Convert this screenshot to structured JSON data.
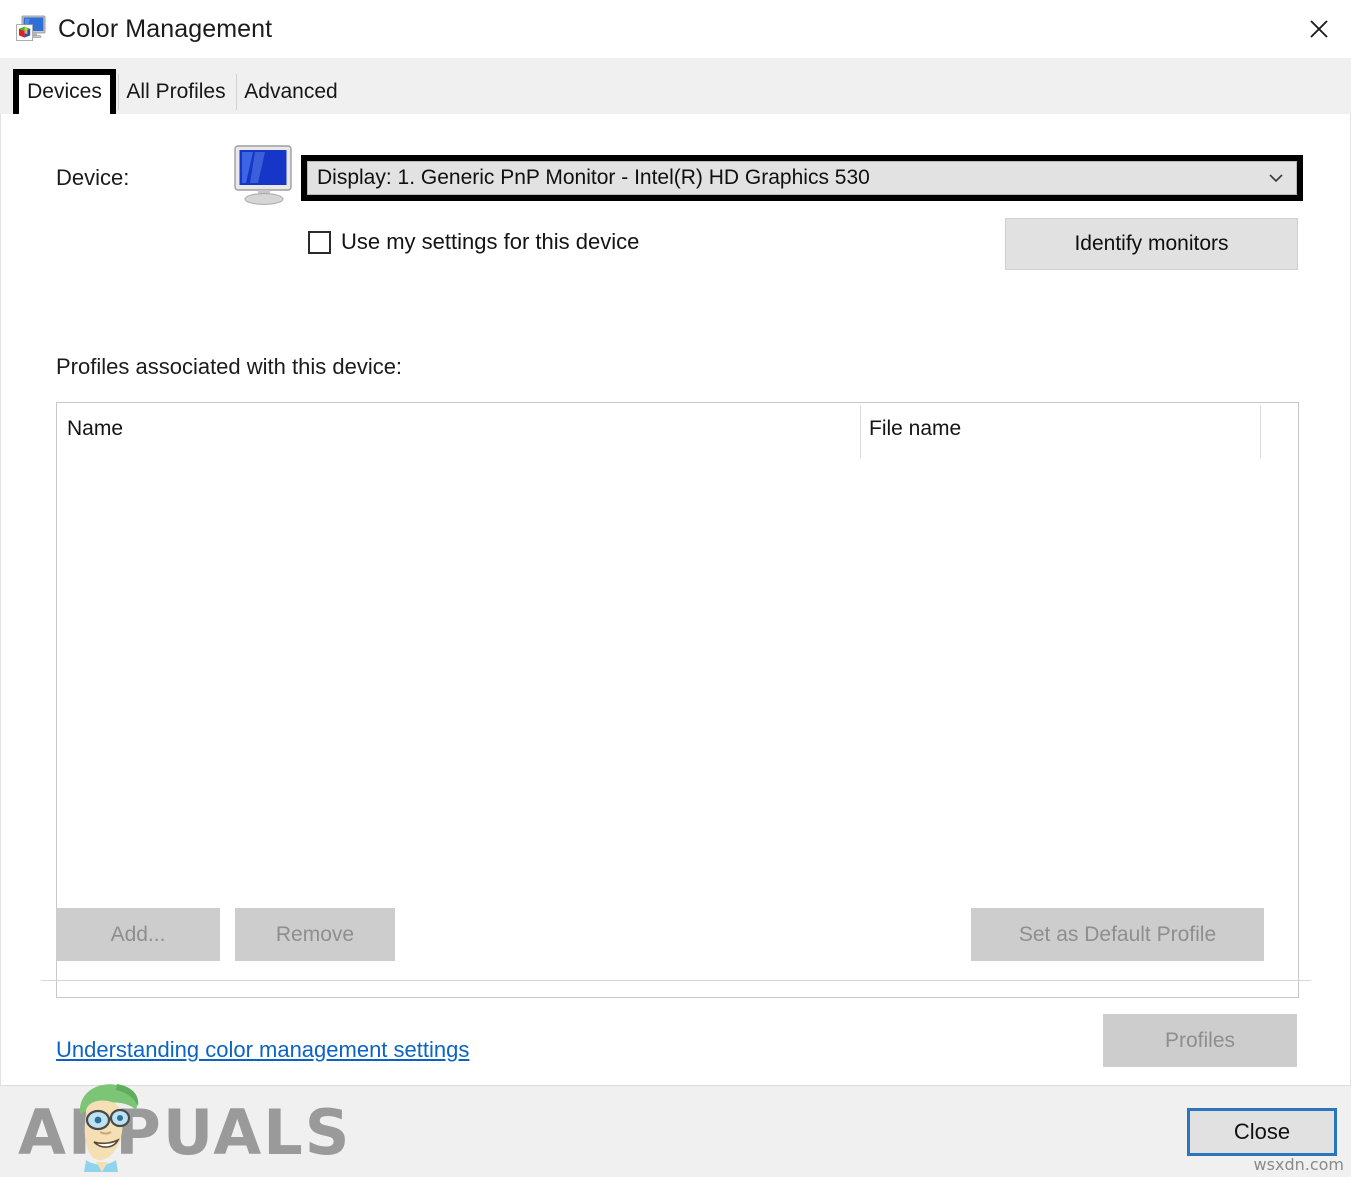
{
  "window": {
    "title": "Color Management",
    "icon": "color-management-icon",
    "close_icon": "close-icon"
  },
  "tabs": [
    {
      "label": "Devices",
      "active": true
    },
    {
      "label": "All Profiles",
      "active": false
    },
    {
      "label": "Advanced",
      "active": false
    }
  ],
  "device_section": {
    "label": "Device:",
    "icon": "monitor-icon",
    "combo_value": "Display: 1. Generic PnP Monitor - Intel(R) HD Graphics 530",
    "combo_arrow_icon": "chevron-down-icon",
    "checkbox_label": "Use my settings for this device",
    "checkbox_checked": false,
    "identify_button": "Identify monitors"
  },
  "profiles_section": {
    "label": "Profiles associated with this device:",
    "columns": [
      "Name",
      "File name"
    ],
    "rows": [],
    "add_button": "Add...",
    "remove_button": "Remove",
    "set_default_button": "Set as Default Profile",
    "add_enabled": false,
    "remove_enabled": false,
    "set_default_enabled": false
  },
  "footer_links": {
    "understanding_link": "Understanding color management settings",
    "profiles_button": "Profiles",
    "profiles_enabled": false
  },
  "dialog_footer": {
    "close_button": "Close"
  },
  "watermarks": {
    "brand": "APPUALS",
    "site": "wsxdn.com"
  },
  "colors": {
    "accent_blue": "#2a76bd",
    "link_blue": "#0c63c4",
    "tabstrip_bg": "#f0f0f0",
    "button_bg": "#e1e1e1",
    "button_disabled_bg": "#cdcdcd",
    "button_disabled_text": "#8e8e8e",
    "annotation_black": "#000000"
  }
}
